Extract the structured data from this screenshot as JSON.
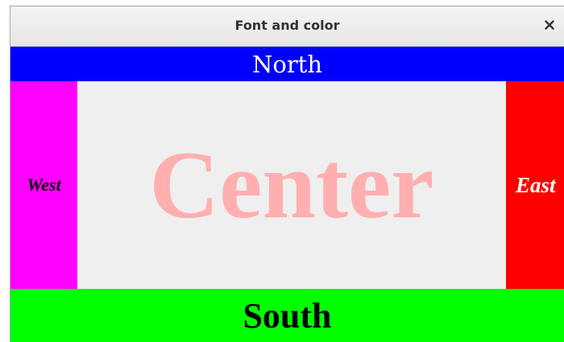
{
  "window": {
    "title": "Font and color",
    "close_icon": "close-icon",
    "close_glyph": "×"
  },
  "regions": {
    "north": {
      "label": "North",
      "background": "#0000ff",
      "color": "#ffffff"
    },
    "west": {
      "label": "West",
      "background": "#ff00ff",
      "color": "#000000"
    },
    "center": {
      "label": "Center",
      "background": "#efefef",
      "color": "#ffafaf"
    },
    "east": {
      "label": "East",
      "background": "#ff0000",
      "color": "#ffffff"
    },
    "south": {
      "label": "South",
      "background": "#00ff00",
      "color": "#000000"
    }
  }
}
